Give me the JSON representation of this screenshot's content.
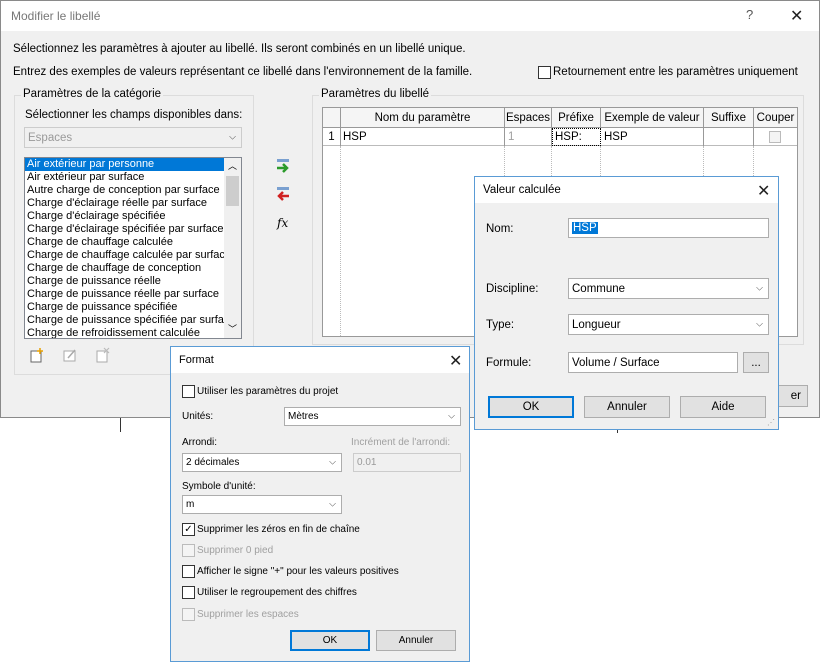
{
  "main": {
    "title": "Modifier le libellé",
    "help": "?",
    "close": "✕",
    "instr1": "Sélectionnez les paramètres à ajouter au libellé. Ils seront combinés en un libellé unique.",
    "instr2": "Entrez des exemples de valeurs représentant ce libellé dans l'environnement de la famille.",
    "retour_label": "Retournement entre les paramètres uniquement",
    "cat_group": "Paramètres de la catégorie",
    "select_fields_label": "Sélectionner les champs disponibles dans:",
    "source_combo": "Espaces",
    "fields": [
      "Air extérieur par personne",
      "Air extérieur par surface",
      "Autre charge de conception par surface",
      "Charge d'éclairage réelle par surface",
      "Charge d'éclairage spécifiée",
      "Charge d'éclairage spécifiée par surface",
      "Charge de chauffage calculée",
      "Charge de chauffage calculée par surface",
      "Charge de chauffage de conception",
      "Charge de puissance réelle",
      "Charge de puissance réelle par surface",
      "Charge de puissance spécifiée",
      "Charge de puissance spécifiée par surface",
      "Charge de refroidissement calculée"
    ],
    "fx_label": "fx",
    "label_group": "Paramètres du libellé",
    "table_headers": [
      "",
      "Nom du paramètre",
      "Espaces",
      "Préfixe",
      "Exemple de valeur",
      "Suffixe",
      "Couper"
    ],
    "row": {
      "num": "1",
      "name": "HSP",
      "espaces": "1",
      "prefixe": "HSP:",
      "exemple": "HSP",
      "suffixe": ""
    },
    "partial_button": "er"
  },
  "valeur": {
    "title": "Valeur calculée",
    "close": "✕",
    "nom_label": "Nom:",
    "nom_value": "HSP",
    "discipline_label": "Discipline:",
    "discipline_value": "Commune",
    "type_label": "Type:",
    "type_value": "Longueur",
    "formule_label": "Formule:",
    "formule_value": "Volume / Surface",
    "ellipsis": "...",
    "ok": "OK",
    "annuler": "Annuler",
    "aide": "Aide"
  },
  "format": {
    "title": "Format",
    "close": "✕",
    "use_project": "Utiliser les paramètres du projet",
    "unites_label": "Unités:",
    "unites_value": "Mètres",
    "arrondi_label": "Arrondi:",
    "arrondi_value": "2 décimales",
    "increment_label": "Incrément de l'arrondi:",
    "increment_value": "0.01",
    "symbole_label": "Symbole d'unité:",
    "symbole_value": "m",
    "supprimer_zeros": "Supprimer les zéros en fin de chaîne",
    "supprimer_pied": "Supprimer 0 pied",
    "afficher_signe": "Afficher le signe \"+\" pour les valeurs positives",
    "regroupement": "Utiliser le regroupement des chiffres",
    "supprimer_espaces": "Supprimer les espaces",
    "ok": "OK",
    "annuler": "Annuler"
  }
}
